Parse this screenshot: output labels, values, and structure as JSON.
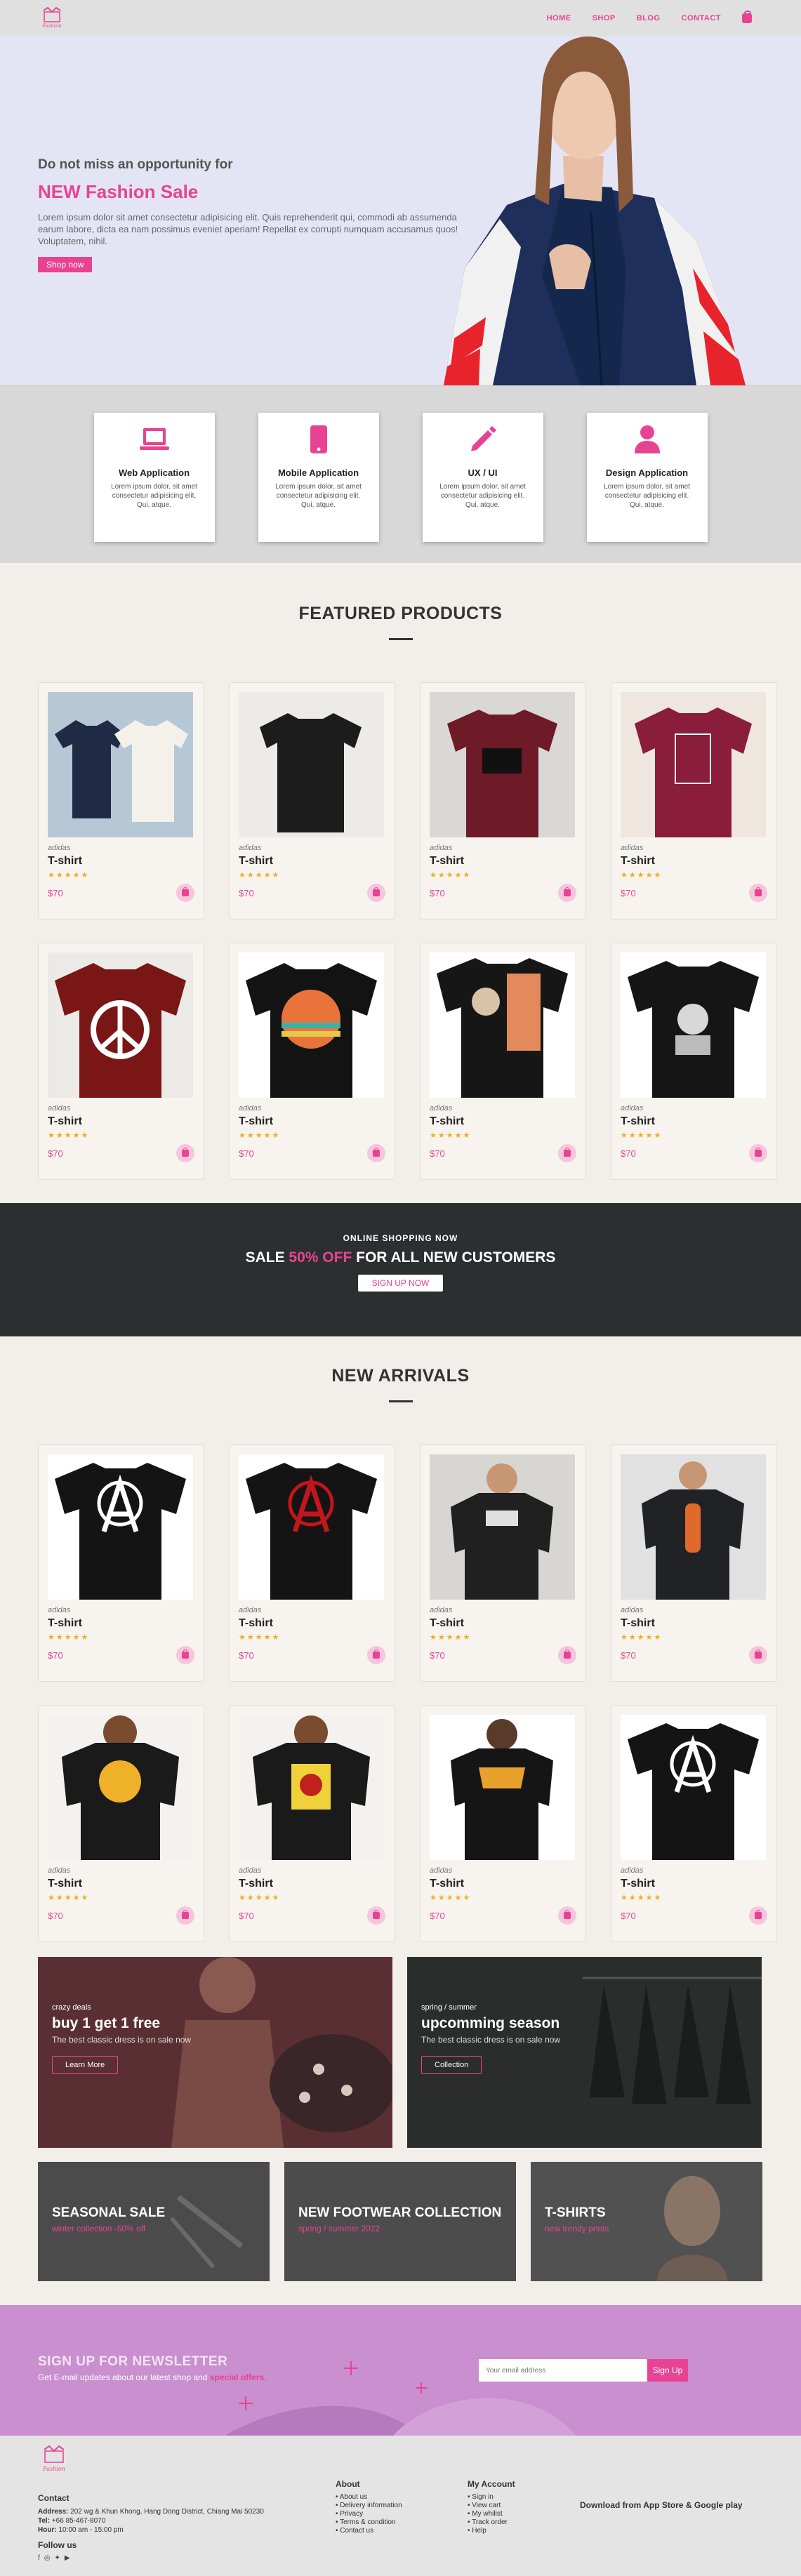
{
  "nav": {
    "links": [
      "HOME",
      "SHOP",
      "BLOG",
      "CONTACT"
    ],
    "logo_text": "Fashion"
  },
  "hero": {
    "pretitle": "Do not miss an opportunity for",
    "title": "NEW Fashion Sale",
    "description": "Lorem ipsum dolor sit amet consectetur adipisicing elit. Quis reprehenderit qui, commodi ab assumenda earum labore, dicta ea nam possimus eveniet aperiam! Repellat ex corrupti numquam accusamus quos! Voluptatem, nihil.",
    "button": "Shop now"
  },
  "services": [
    {
      "title": "Web Application",
      "desc": "Lorem ipsum dolor, sit amet consectetur adipisicing elit. Qui, atque.",
      "icon": "laptop-icon"
    },
    {
      "title": "Mobile Application",
      "desc": "Lorem ipsum dolor, sit amet consectetur adipisicing elit. Qui, atque.",
      "icon": "mobile-icon"
    },
    {
      "title": "UX / UI",
      "desc": "Lorem ipsum dolor, sit amet consectetur adipisicing elit. Qui, atque.",
      "icon": "pencil-icon"
    },
    {
      "title": "Design Application",
      "desc": "Lorem ipsum dolor, sit amet consectetur adipisicing elit. Qui, atque.",
      "icon": "user-icon"
    }
  ],
  "featured": {
    "title": "FEATURED PRODUCTS",
    "products": [
      {
        "brand": "adidas",
        "name": "T-shirt",
        "price": "$70",
        "stars": "★★★★★"
      },
      {
        "brand": "adidas",
        "name": "T-shirt",
        "price": "$70",
        "stars": "★★★★★"
      },
      {
        "brand": "adidas",
        "name": "T-shirt",
        "price": "$70",
        "stars": "★★★★★"
      },
      {
        "brand": "adidas",
        "name": "T-shirt",
        "price": "$70",
        "stars": "★★★★★"
      },
      {
        "brand": "adidas",
        "name": "T-shirt",
        "price": "$70",
        "stars": "★★★★★"
      },
      {
        "brand": "adidas",
        "name": "T-shirt",
        "price": "$70",
        "stars": "★★★★★"
      },
      {
        "brand": "adidas",
        "name": "T-shirt",
        "price": "$70",
        "stars": "★★★★★"
      },
      {
        "brand": "adidas",
        "name": "T-shirt",
        "price": "$70",
        "stars": "★★★★★"
      }
    ]
  },
  "banner": {
    "pretitle": "ONLINE SHOPPING NOW",
    "main_a": "SALE ",
    "main_hl": "50% OFF",
    "main_b": " FOR ALL NEW CUSTOMERS",
    "button": "SIGN UP NOW"
  },
  "arrivals": {
    "title": "NEW ARRIVALS",
    "products": [
      {
        "brand": "adidas",
        "name": "T-shirt",
        "price": "$70",
        "stars": "★★★★★"
      },
      {
        "brand": "adidas",
        "name": "T-shirt",
        "price": "$70",
        "stars": "★★★★★"
      },
      {
        "brand": "adidas",
        "name": "T-shirt",
        "price": "$70",
        "stars": "★★★★★"
      },
      {
        "brand": "adidas",
        "name": "T-shirt",
        "price": "$70",
        "stars": "★★★★★"
      },
      {
        "brand": "adidas",
        "name": "T-shirt",
        "price": "$70",
        "stars": "★★★★★"
      },
      {
        "brand": "adidas",
        "name": "T-shirt",
        "price": "$70",
        "stars": "★★★★★"
      },
      {
        "brand": "adidas",
        "name": "T-shirt",
        "price": "$70",
        "stars": "★★★★★"
      },
      {
        "brand": "adidas",
        "name": "T-shirt",
        "price": "$70",
        "stars": "★★★★★"
      }
    ]
  },
  "promos": [
    {
      "small": "crazy deals",
      "big": "buy 1 get 1 free",
      "sub": "The best classic dress is on sale now",
      "button": "Learn More"
    },
    {
      "small": "spring / summer",
      "big": "upcomming season",
      "sub": "The best classic dress is on sale now",
      "button": "Collection"
    }
  ],
  "small_promos": [
    {
      "title": "SEASONAL SALE",
      "sub": "winter collection -50% off"
    },
    {
      "title": "NEW FOOTWEAR COLLECTION",
      "sub": "spring / summer 2022"
    },
    {
      "title": "T-SHIRTS",
      "sub": "new trendy prints"
    }
  ],
  "newsletter": {
    "title": "SIGN UP FOR NEWSLETTER",
    "desc_a": "Get E-mail updates about our latest shop and ",
    "desc_hl": "special offers.",
    "placeholder": "Your email address",
    "button": "Sign Up"
  },
  "footer": {
    "contact_title": "Contact",
    "address_label": "Address:",
    "address": " 202 wg & Khun Khong, Hang Dong District, Chiang Mai 50230",
    "tel_label": "Tel:",
    "tel": " +66 85-467-8070",
    "hour_label": "Hour:",
    "hour": " 10:00 am - 15:00 pm",
    "follow": "Follow us",
    "about_title": "About",
    "about_links": [
      "About us",
      "Delivery information",
      "Privacy",
      "Terms & condition",
      "Contact us"
    ],
    "account_title": "My Account",
    "account_links": [
      "Sign in",
      "View cart",
      "My whilist",
      "Track order",
      "Help"
    ],
    "download": "Download from App Store & Google play"
  }
}
